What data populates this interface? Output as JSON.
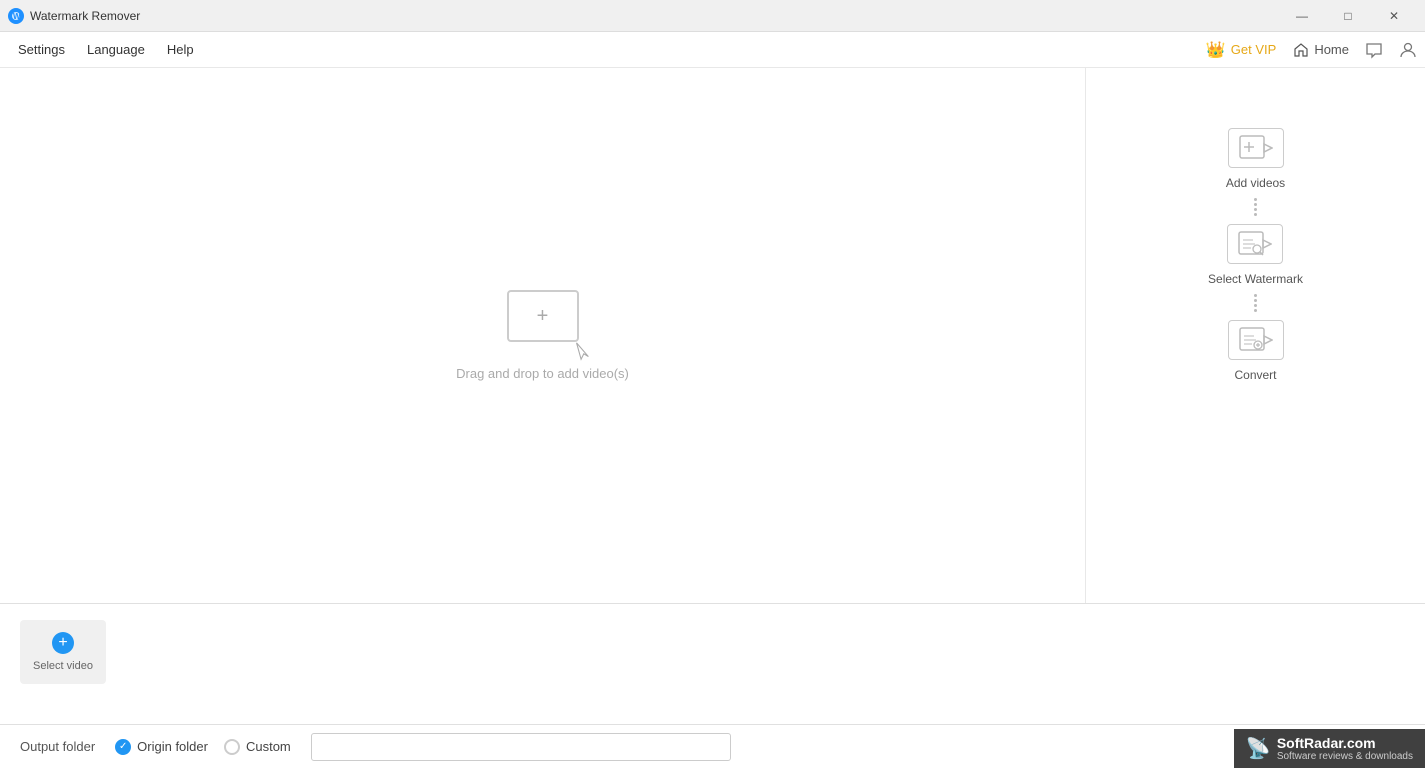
{
  "titleBar": {
    "appName": "Watermark Remover",
    "minimizeLabel": "—",
    "maximizeLabel": "□",
    "closeLabel": "✕"
  },
  "menuBar": {
    "items": [
      "Settings",
      "Language",
      "Help"
    ],
    "vipButton": "Get VIP",
    "homeButton": "Home"
  },
  "dropZone": {
    "text": "Drag and drop to add video(s)"
  },
  "rightSidebar": {
    "step1Label": "Add videos",
    "step2Label": "Select Watermark",
    "step3Label": "Convert"
  },
  "bottomArea": {
    "selectVideoLabel": "Select video"
  },
  "footer": {
    "outputFolderLabel": "Output folder",
    "originFolderLabel": "Origin folder",
    "customLabel": "Custom",
    "pathPlaceholder": ""
  },
  "softradar": {
    "name": "SoftRadar.com",
    "tagline": "Software reviews & downloads"
  }
}
